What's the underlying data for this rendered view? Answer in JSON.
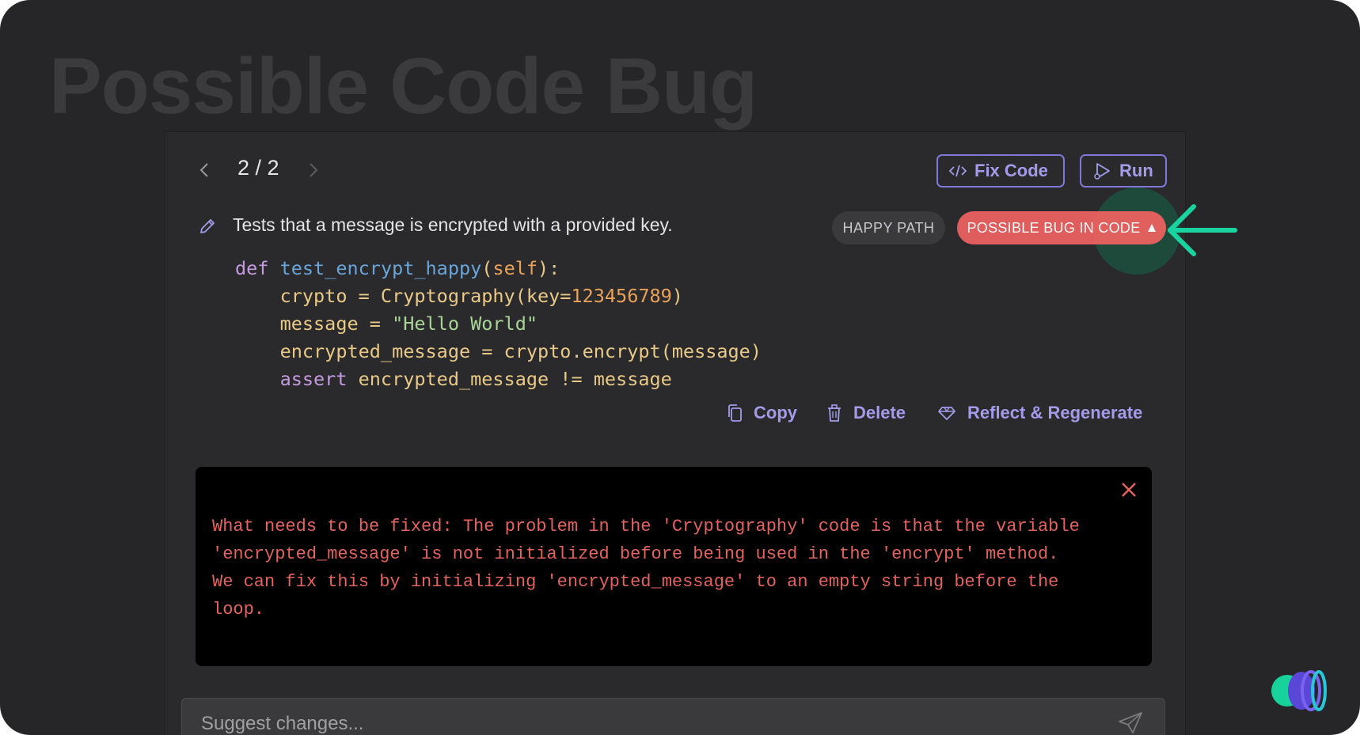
{
  "page_title": "Possible Code Bug",
  "pager": {
    "text": "2 / 2"
  },
  "toolbar": {
    "fix_label": "Fix Code",
    "run_label": "Run"
  },
  "test": {
    "description": "Tests that a message is encrypted with a provided key.",
    "tag_happy": "HAPPY PATH",
    "tag_bug": "POSSIBLE BUG IN CODE"
  },
  "code": {
    "line1": {
      "kw": "def",
      "fn": "test_encrypt_happy",
      "open": "(",
      "self": "self",
      "close": "):"
    },
    "line2": {
      "a": "    crypto = Cryptography(key=",
      "num": "123456789",
      "b": ")"
    },
    "line3": {
      "a": "    message = ",
      "str": "\"Hello World\""
    },
    "line4": {
      "a": "    encrypted_message = crypto.encrypt(message)"
    },
    "line5": {
      "kw": "    assert",
      "a": " encrypted_message != message"
    }
  },
  "actions": {
    "copy": "Copy",
    "delete": "Delete",
    "reflect": "Reflect & Regenerate"
  },
  "error": {
    "text": "What needs to be fixed: The problem in the 'Cryptography' code is that the variable\n'encrypted_message' is not initialized before being used in the 'encrypt' method.\nWe can fix this by initializing 'encrypted_message' to an empty string before the\nloop."
  },
  "suggest": {
    "placeholder": "Suggest changes..."
  },
  "colors": {
    "accent": "#a39be9",
    "bug": "#e7615f",
    "arrow": "#19d4a1",
    "background": "#262628"
  },
  "icons": [
    "chevron-left-icon",
    "chevron-right-icon",
    "code-icon",
    "run-icon",
    "pencil-icon",
    "triangle-up-icon",
    "arrow-left-icon",
    "copy-icon",
    "trash-icon",
    "diamond-icon",
    "close-icon",
    "send-icon",
    "logo-icon"
  ]
}
